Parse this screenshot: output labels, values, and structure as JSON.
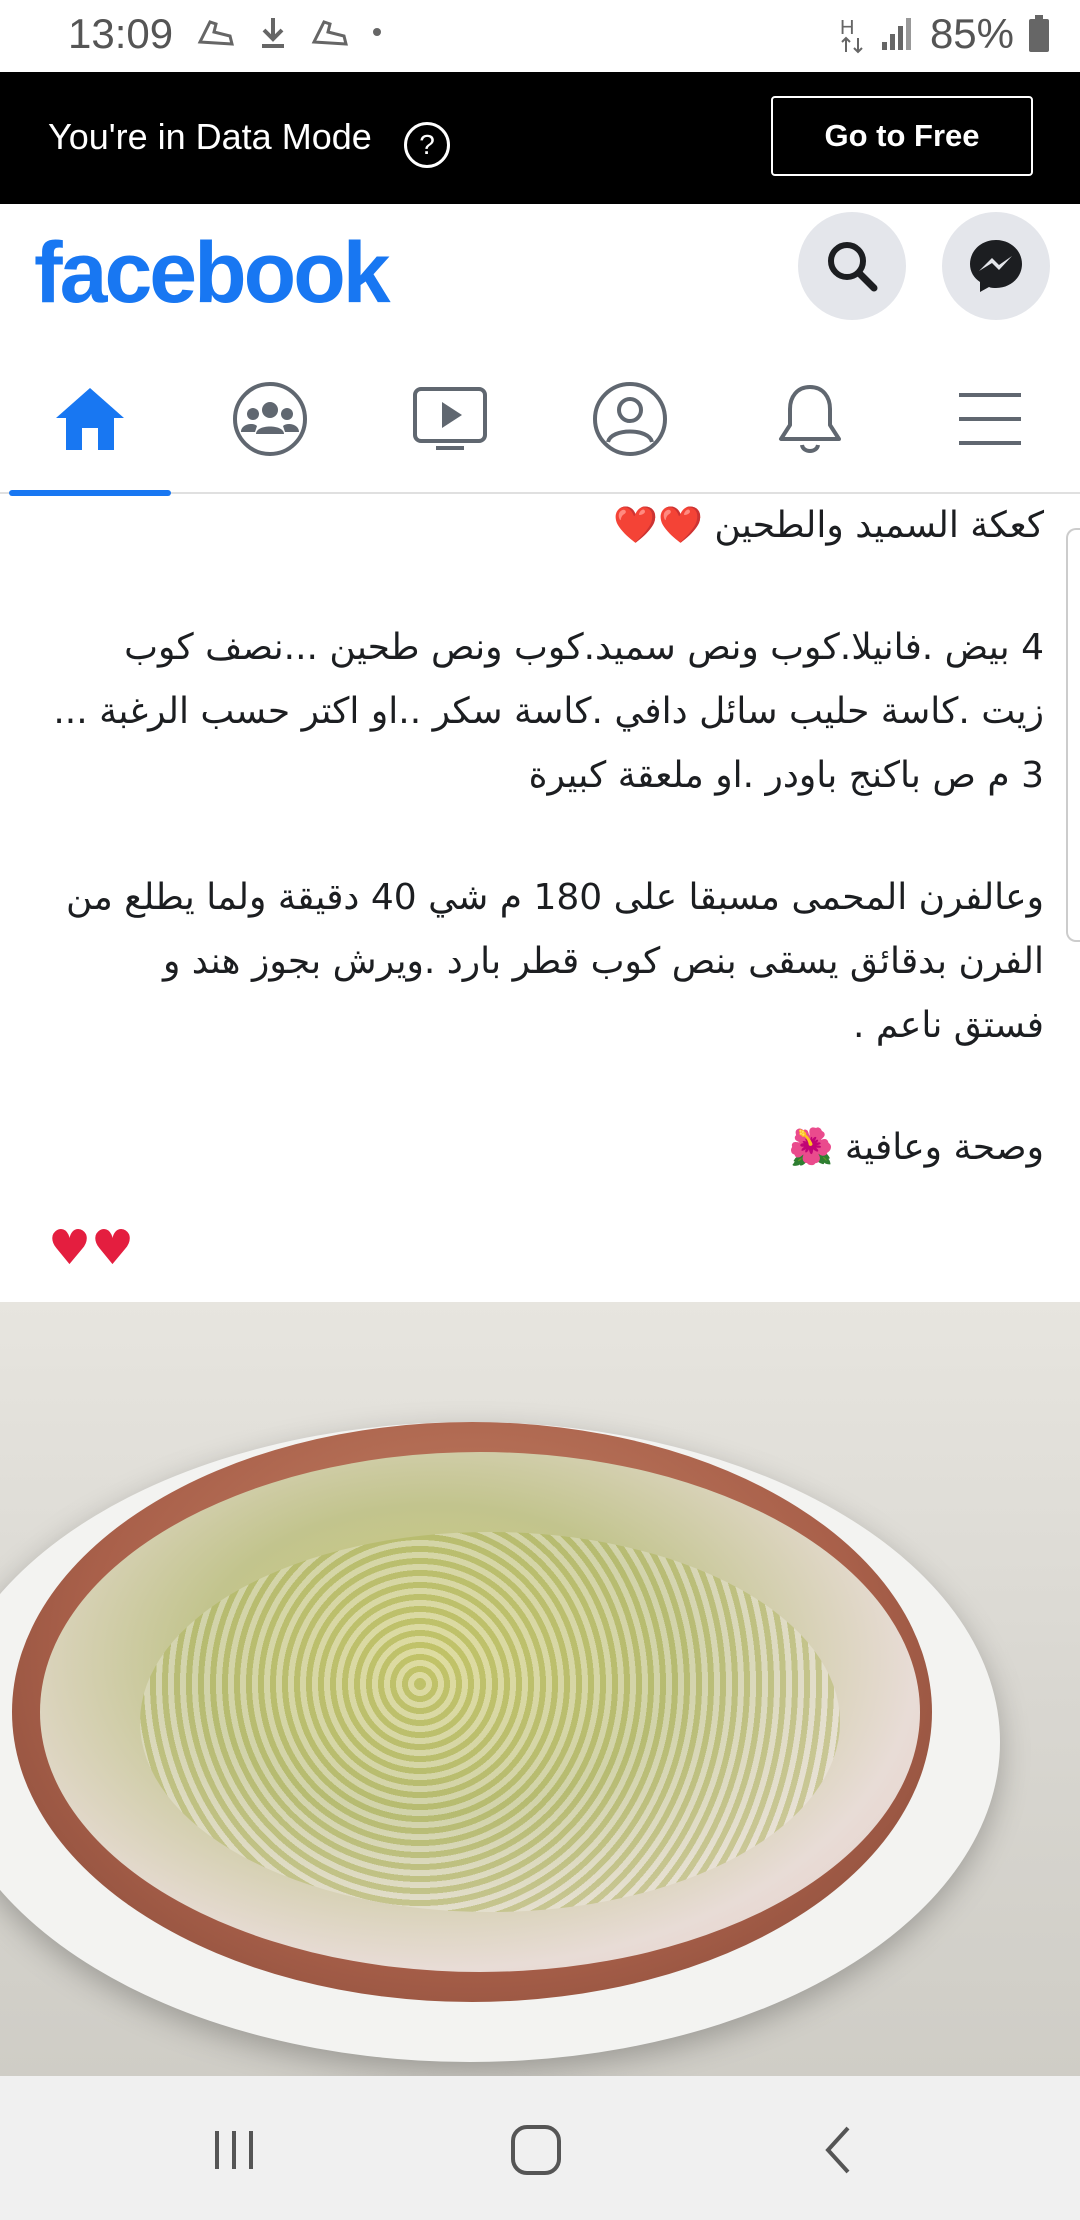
{
  "status_bar": {
    "time": "13:09",
    "battery": "85%",
    "icons": [
      "shoe-icon",
      "download-icon",
      "shoe-icon",
      "dot-icon",
      "network-h-icon",
      "signal-icon",
      "battery-icon"
    ]
  },
  "data_banner": {
    "text": "You're in Data Mode",
    "help_symbol": "?",
    "go_free_label": "Go to Free"
  },
  "header": {
    "logo": "facebook",
    "brand_color": "#1877f2",
    "actions": [
      "search-icon",
      "messenger-icon"
    ]
  },
  "nav": {
    "tabs": [
      {
        "name": "home",
        "icon": "home-icon",
        "active": true
      },
      {
        "name": "groups",
        "icon": "groups-icon",
        "active": false
      },
      {
        "name": "watch",
        "icon": "video-icon",
        "active": false
      },
      {
        "name": "profile",
        "icon": "profile-icon",
        "active": false
      },
      {
        "name": "notifications",
        "icon": "bell-icon",
        "active": false
      },
      {
        "name": "menu",
        "icon": "hamburger-icon",
        "active": false
      }
    ]
  },
  "post": {
    "title": "كعكة السميد والطحين ❤️❤️",
    "ingredients": [
      "4 بيض .فانيلا.كوب ونص سميد.كوب ونص طحين ...نصف كوب",
      "زيت .كاسة حليب سائل دافي  .كاسة سكر ..او اكتر حسب الرغبة ...",
      "3 م ص باكنج باودر .او ملعقة كبيرة"
    ],
    "method": [
      "وعالفرن المحمى مسبقا على 180 م شي 40 دقيقة ولما يطلع من",
      "الفرن  بدقائق يسقى بنص كوب قطر بارد .ويرش بجوز هند و",
      "فستق ناعم ."
    ],
    "closing": "وصحة وعافية 🌺",
    "hearts": "♥♥"
  }
}
